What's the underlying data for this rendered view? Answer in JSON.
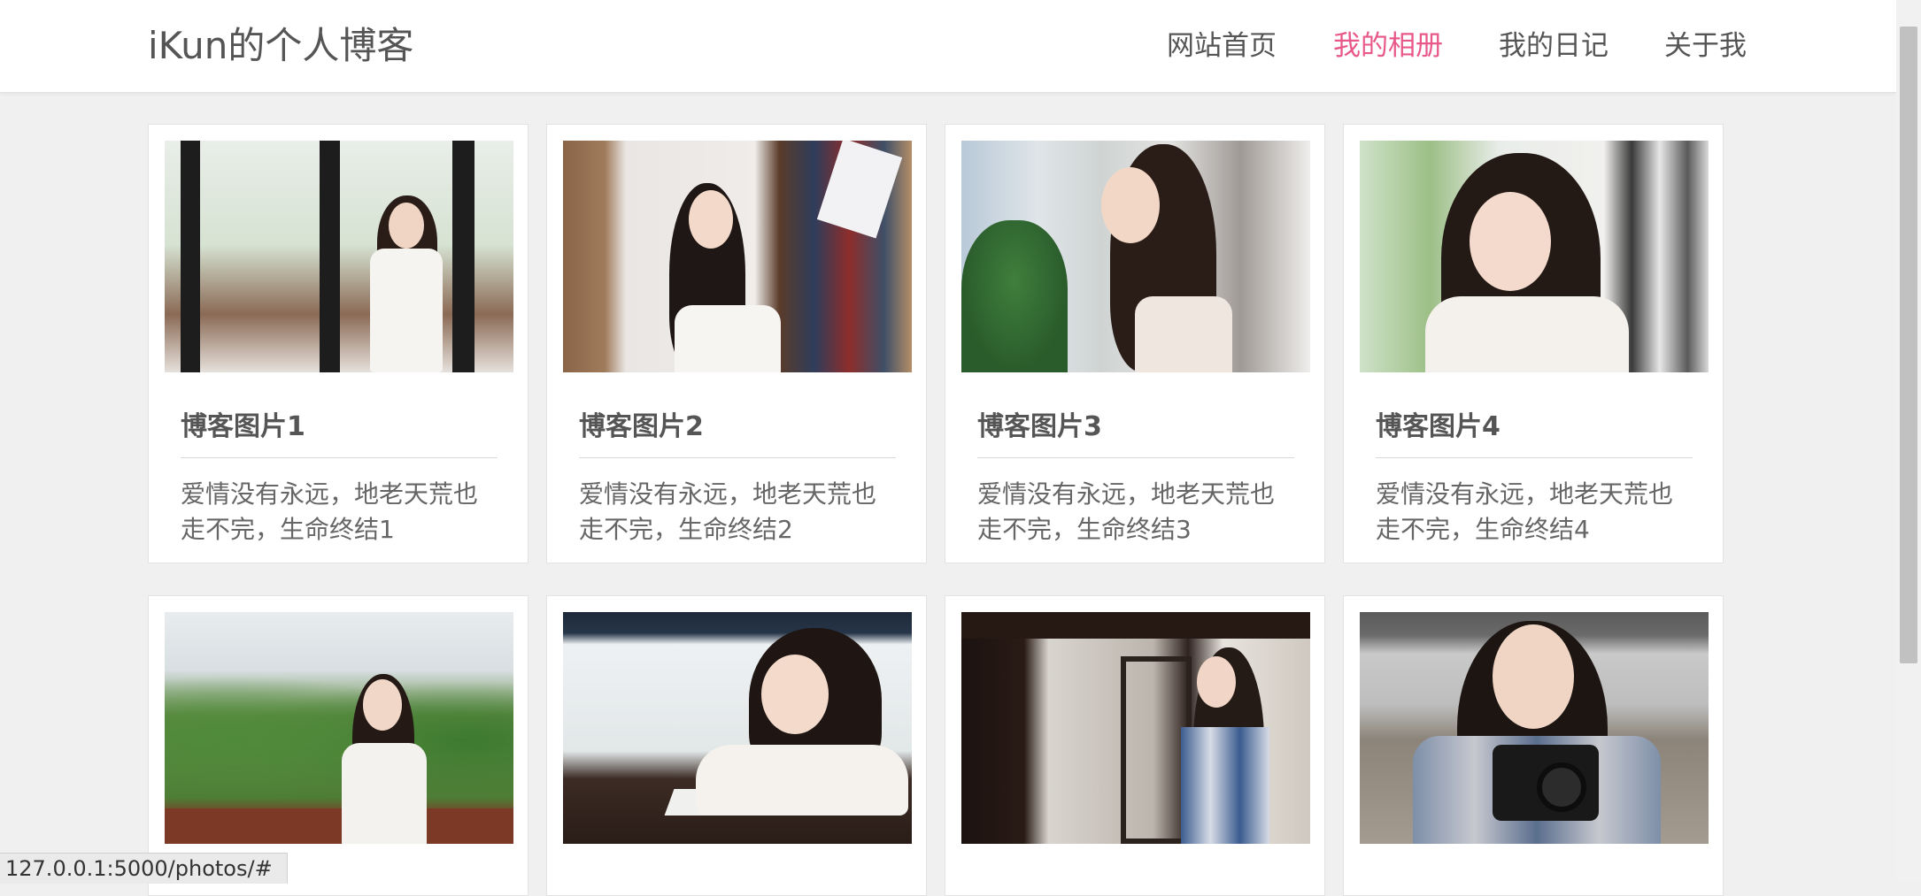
{
  "header": {
    "brand": "iKun的个人博客",
    "nav": [
      {
        "label": "网站首页",
        "active": false
      },
      {
        "label": "我的相册",
        "active": true
      },
      {
        "label": "我的日记",
        "active": false
      },
      {
        "label": "关于我",
        "active": false
      }
    ],
    "active_color": "#e8588a"
  },
  "cards": [
    {
      "title": "博客图片1",
      "desc": "爱情没有永远，地老天荒也走不完，生命终结1"
    },
    {
      "title": "博客图片2",
      "desc": "爱情没有永远，地老天荒也走不完，生命终结2"
    },
    {
      "title": "博客图片3",
      "desc": "爱情没有永远，地老天荒也走不完，生命终结3"
    },
    {
      "title": "博客图片4",
      "desc": "爱情没有永远，地老天荒也走不完，生命终结4"
    },
    {
      "title": "",
      "desc": ""
    },
    {
      "title": "",
      "desc": ""
    },
    {
      "title": "",
      "desc": ""
    },
    {
      "title": "",
      "desc": ""
    }
  ],
  "status_bar": {
    "url": "127.0.0.1:5000/photos/#"
  }
}
